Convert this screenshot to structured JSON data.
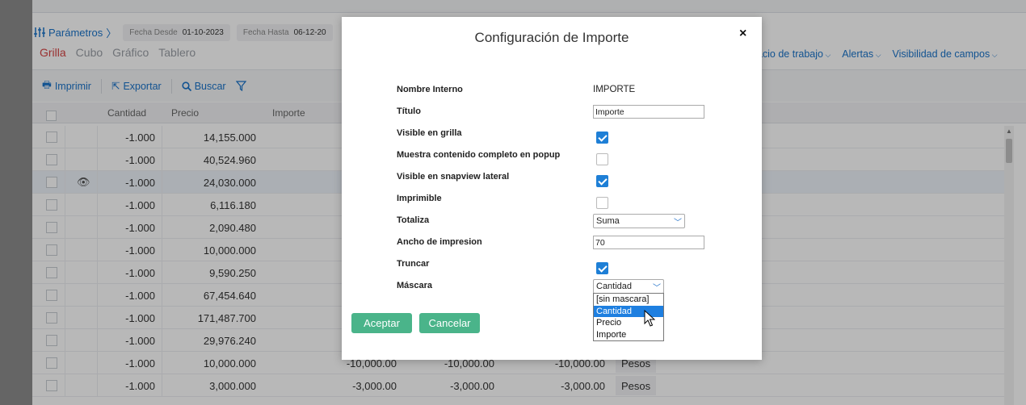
{
  "header": {
    "params_label": "Parámetros",
    "fecha_desde_label": "Fecha Desde",
    "fecha_desde_value": "01-10-2023",
    "fecha_hasta_label": "Fecha Hasta",
    "fecha_hasta_value": "06-12-20"
  },
  "view_tabs": [
    "Grilla",
    "Cubo",
    "Gráfico",
    "Tablero"
  ],
  "right_menu": [
    "pacio de trabajo",
    "Alertas",
    "Visibilidad de campos"
  ],
  "toolbar": {
    "print": "Imprimir",
    "export": "Exportar",
    "search": "Buscar"
  },
  "grid": {
    "columns": {
      "cantidad": "Cantidad",
      "precio": "Precio",
      "importe": "Importe"
    },
    "rows": [
      {
        "cantidad": "-1.000",
        "precio": "14,155.000"
      },
      {
        "cantidad": "-1.000",
        "precio": "40,524.960"
      },
      {
        "cantidad": "-1.000",
        "precio": "24,030.000"
      },
      {
        "cantidad": "-1.000",
        "precio": "6,116.180"
      },
      {
        "cantidad": "-1.000",
        "precio": "2,090.480"
      },
      {
        "cantidad": "-1.000",
        "precio": "10,000.000"
      },
      {
        "cantidad": "-1.000",
        "precio": "9,590.250"
      },
      {
        "cantidad": "-1.000",
        "precio": "67,454.640"
      },
      {
        "cantidad": "-1.000",
        "precio": "171,487.700"
      },
      {
        "cantidad": "-1.000",
        "precio": "29,976.240"
      },
      {
        "cantidad": "-1.000",
        "precio": "10,000.000",
        "c1": "-10,000.00",
        "c2": "-10,000.00",
        "c3": "-10,000.00",
        "c4": "Pesos"
      },
      {
        "cantidad": "-1.000",
        "precio": "3,000.000",
        "c1": "-3,000.00",
        "c2": "-3,000.00",
        "c3": "-3,000.00",
        "c4": "Pesos"
      }
    ]
  },
  "modal": {
    "title": "Configuración de Importe",
    "close": "×",
    "fields": {
      "nombre_interno": {
        "label": "Nombre Interno",
        "value": "IMPORTE"
      },
      "titulo": {
        "label": "Título",
        "value": "Importe"
      },
      "visible_grilla": {
        "label": "Visible en grilla",
        "checked": true
      },
      "muestra_popup": {
        "label": "Muestra contenido completo en popup",
        "checked": false
      },
      "visible_snapview": {
        "label": "Visible en snapview lateral",
        "checked": true
      },
      "imprimible": {
        "label": "Imprimible",
        "checked": false
      },
      "totaliza": {
        "label": "Totaliza",
        "value": "Suma"
      },
      "ancho": {
        "label": "Ancho de impresion",
        "value": "70"
      },
      "truncar": {
        "label": "Truncar",
        "checked": true
      },
      "mascara": {
        "label": "Máscara",
        "value": "Cantidad"
      }
    },
    "mascara_options": [
      "[sin mascara]",
      "Cantidad",
      "Precio",
      "Importe"
    ],
    "accept": "Aceptar",
    "cancel": "Cancelar"
  },
  "colors": {
    "accent": "#1a73c9",
    "button": "#4ab48a",
    "active_tab": "#d64545",
    "check": "#1e7fd6"
  }
}
